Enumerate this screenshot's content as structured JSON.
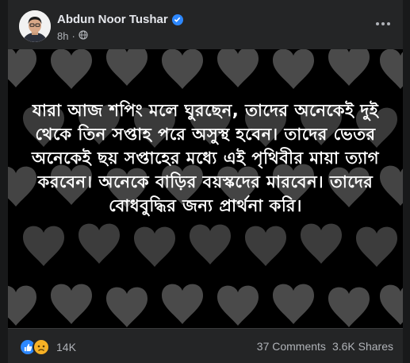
{
  "post": {
    "author": "Abdun Noor Tushar",
    "time": "8h",
    "visibility_icon": "globe-icon",
    "text": "যারা আজ শপিং মলে ঘুরছেন, তাদের অনেকেই দুই থেকে তিন সপ্তাহ পরে অসুস্থ হবেন। তাদের ভেতর অনেকেই ছয় সপ্তাহের মধ্যে এই পৃথিবীর মায়া ত্যাগ করবেন। অনেকে বাড়ির বয়স্কদের মারবেন। তাদের বোধবুদ্ধির জন্য প্রার্থনা করি।",
    "image_background": "heart-pattern"
  },
  "footer": {
    "reaction_count": "14K",
    "reaction_icons": [
      "like-icon",
      "sad-icon"
    ],
    "comments": "37 Comments",
    "shares": "3.6K Shares"
  },
  "colors": {
    "card_bg": "#242526",
    "page_bg": "#18191a",
    "accent": "#2d88ff",
    "secondary_text": "#b0b3b8",
    "primary_text": "#e4e6eb"
  }
}
